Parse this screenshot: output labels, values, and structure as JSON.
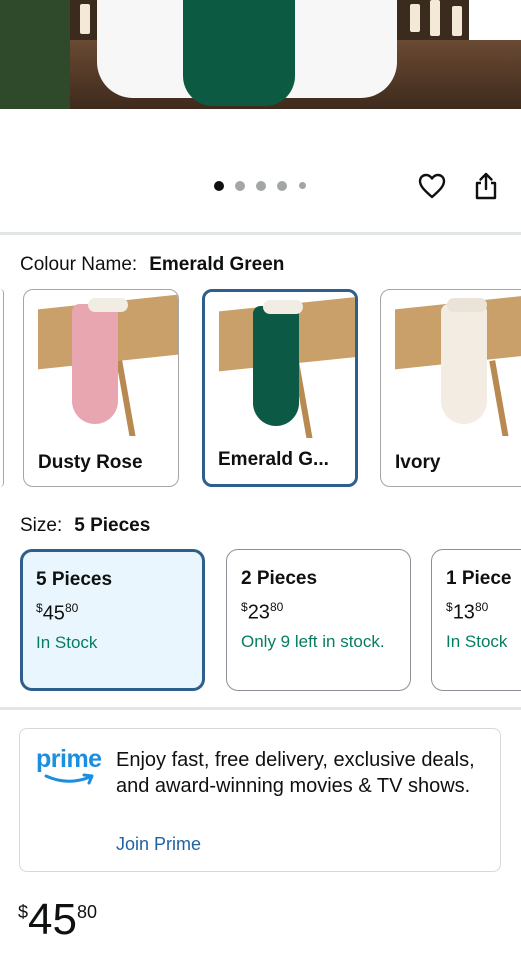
{
  "colour": {
    "label": "Colour Name:",
    "selected": "Emerald Green",
    "options": [
      {
        "name": "Dusty Rose",
        "color": "#e8a6b0"
      },
      {
        "name": "Emerald G...",
        "color": "#0c5a45"
      },
      {
        "name": "Ivory",
        "color": "#f2ece2"
      }
    ]
  },
  "size": {
    "label": "Size:",
    "selected": "5 Pieces",
    "options": [
      {
        "name": "5 Pieces",
        "currency": "$",
        "whole": "45",
        "fraction": "80",
        "stock": "In Stock"
      },
      {
        "name": "2 Pieces",
        "currency": "$",
        "whole": "23",
        "fraction": "80",
        "stock": "Only 9 left in stock."
      },
      {
        "name": "1 Piece",
        "currency": "$",
        "whole": "13",
        "fraction": "80",
        "stock": "In Stock"
      }
    ]
  },
  "prime": {
    "logo_text": "prime",
    "message": "Enjoy fast, free delivery, exclusive deals, and award-winning movies & TV shows.",
    "join_label": "Join Prime"
  },
  "price": {
    "currency": "$",
    "whole": "45",
    "fraction": "80"
  },
  "carousel": {
    "slide_count": 5,
    "active_index": 0
  },
  "icons": {
    "wishlist": "heart-icon",
    "share": "share-icon",
    "prime_smile": "prime-smile-icon"
  },
  "colors": {
    "accent": "#2f5e8c",
    "stock": "#067d62",
    "link": "#2162a1",
    "prime": "#1a8ee0"
  }
}
